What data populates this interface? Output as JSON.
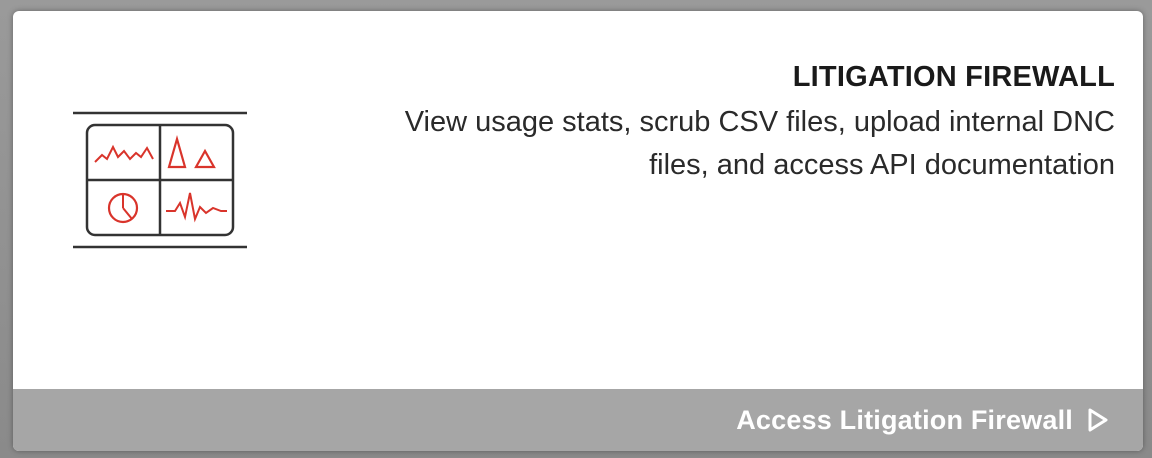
{
  "card": {
    "title": "LITIGATION FIREWALL",
    "description": "View usage stats, scrub CSV files, upload internal DNC files, and access API documentation",
    "icon": "dashboard-charts-icon",
    "accent_color": "#d9342b",
    "footer": {
      "link_label": "Access Litigation Firewall",
      "arrow_icon": "play-outline-arrow-icon",
      "background": "#a6a6a6"
    }
  }
}
